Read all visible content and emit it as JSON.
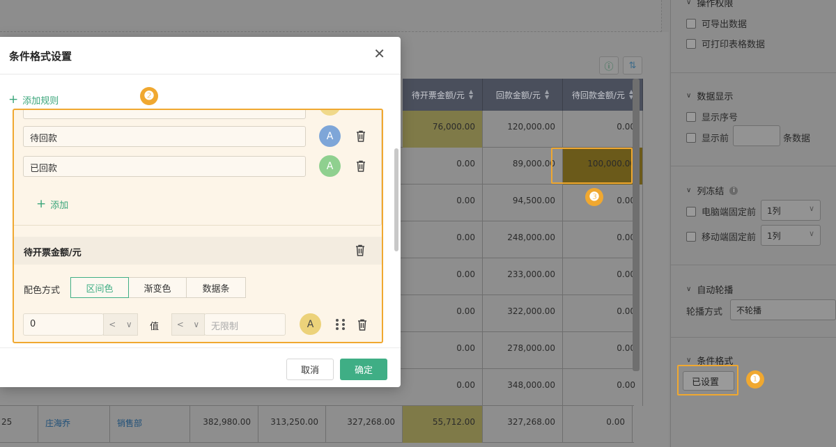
{
  "modal": {
    "title": "条件格式设置",
    "add_rule_label": "添加规则",
    "rule1": {
      "values": [
        "待回款",
        "已回款"
      ],
      "circle_letter": "A",
      "circle_colors": [
        "#f0d98a",
        "#7ea6d8",
        "#8fd08f"
      ],
      "add_label": "添加"
    },
    "rule2": {
      "field_label": "待开票金额/元",
      "color_mode_label": "配色方式",
      "color_modes": [
        "区间色",
        "渐变色",
        "数据条"
      ],
      "active_mode": "区间色",
      "range": {
        "min_value": "0",
        "min_op": "<",
        "value_label": "值",
        "max_op": "<",
        "max_placeholder": "无限制",
        "circle_letter": "A",
        "circle_color": "#ecd27a"
      }
    },
    "cancel_label": "取消",
    "ok_label": "确定"
  },
  "grid": {
    "headers": [
      "待开票金额/元",
      "回款金额/元",
      "待回款金额/元"
    ],
    "rows": [
      {
        "invoice": "76,000.00",
        "received": "120,000.00",
        "pending": "0.00"
      },
      {
        "invoice": "0.00",
        "received": "89,000.00",
        "pending": "100,000.00"
      },
      {
        "invoice": "0.00",
        "received": "94,500.00",
        "pending": "0.00"
      },
      {
        "invoice": "0.00",
        "received": "248,000.00",
        "pending": "0.00"
      },
      {
        "invoice": "0.00",
        "received": "233,000.00",
        "pending": "0.00"
      },
      {
        "invoice": "0.00",
        "received": "322,000.00",
        "pending": "0.00"
      },
      {
        "invoice": "0.00",
        "received": "278,000.00",
        "pending": "0.00"
      },
      {
        "invoice": "0.00",
        "received": "348,000.00",
        "pending": "0.00"
      }
    ],
    "last_row": {
      "id": "25",
      "name": "庄海乔",
      "dept": "销售部",
      "c1": "382,980.00",
      "c2": "313,250.00",
      "c3": "327,268.00",
      "invoice": "55,712.00",
      "received": "327,268.00",
      "pending": "0.00"
    }
  },
  "panel": {
    "permissions_title": "操作权限",
    "perm_export": "可导出数据",
    "perm_print": "可打印表格数据",
    "display_title": "数据显示",
    "show_index": "显示序号",
    "show_first": "显示前",
    "show_first_suffix": "条数据",
    "freeze_title": "列冻结",
    "freeze_pc": "电脑端固定前",
    "freeze_pc_value": "1列",
    "freeze_mobile": "移动端固定前",
    "freeze_mobile_value": "1列",
    "carousel_title": "自动轮播",
    "carousel_mode_label": "轮播方式",
    "carousel_mode_value": "不轮播",
    "cond_title": "条件格式",
    "cond_value": "已设置"
  },
  "callouts": [
    "❶",
    "❷",
    "❸"
  ],
  "accent": "#f0a830",
  "brand_green": "#3fae85"
}
